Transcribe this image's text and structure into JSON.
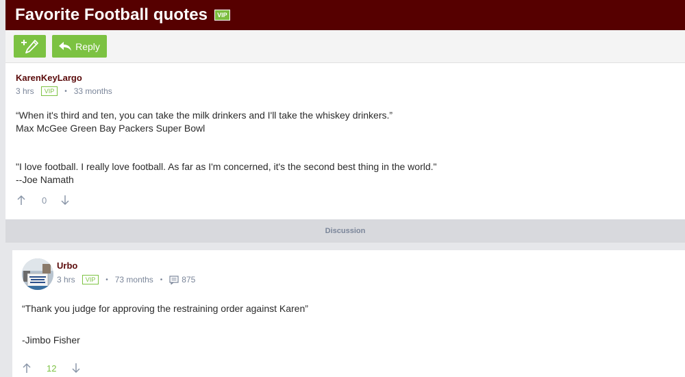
{
  "header": {
    "title": "Favorite Football quotes",
    "badge": "VIP"
  },
  "toolbar": {
    "reply_label": "Reply"
  },
  "post1": {
    "author": "KarenKeyLargo",
    "time": "3 hrs",
    "badge": "VIP",
    "tenure": "33 months",
    "line1": "“When it's third and ten, you can take the milk drinkers and I'll take the whiskey drinkers.”",
    "line2": "Max McGee Green Bay Packers Super Bowl",
    "line3": "\"I love football. I really love football. As far as I'm concerned, it's the second best thing in the world.\"",
    "line4": "--Joe Namath",
    "votes": "0"
  },
  "discussion_label": "Discussion",
  "post2": {
    "author": "Urbo",
    "time": "3 hrs",
    "badge": "VIP",
    "tenure": "73 months",
    "post_count": "875",
    "line1": "“Thank you judge for approving the restraining order against Karen”",
    "line2": "-Jimbo Fisher",
    "votes": "12"
  },
  "colors": {
    "header_bg": "#560000",
    "button_green": "#7cc242",
    "author_color": "#5a0a0a",
    "meta_gray": "#7a8599"
  }
}
